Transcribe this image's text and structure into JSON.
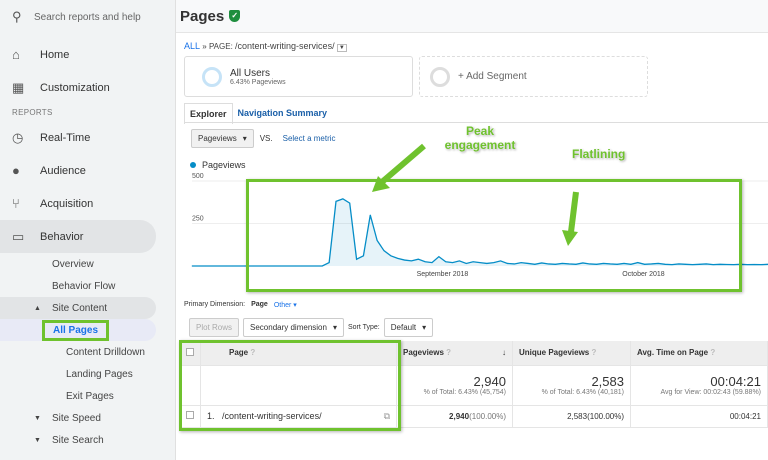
{
  "sidebar": {
    "search_placeholder": "Search reports and help",
    "home": "Home",
    "customization": "Customization",
    "reports_label": "REPORTS",
    "realtime": "Real-Time",
    "audience": "Audience",
    "acquisition": "Acquisition",
    "behavior": "Behavior",
    "overview": "Overview",
    "behavior_flow": "Behavior Flow",
    "site_content": "Site Content",
    "all_pages": "All Pages",
    "content_drilldown": "Content Drilldown",
    "landing_pages": "Landing Pages",
    "exit_pages": "Exit Pages",
    "site_speed": "Site Speed",
    "site_search": "Site Search"
  },
  "header": {
    "title": "Pages"
  },
  "breadcrumb": {
    "all": "ALL",
    "sep": "»",
    "page_label": "PAGE:",
    "page": "/content-writing-services/"
  },
  "segments": {
    "all_users": "All Users",
    "all_users_sub": "6.43% Pageviews",
    "add_segment": "+ Add Segment"
  },
  "tabs": [
    "Explorer",
    "Navigation Summary"
  ],
  "metric": {
    "selected": "Pageviews",
    "vs": "VS.",
    "select_metric": "Select a metric"
  },
  "annotations": {
    "peak": "Peak engagement",
    "flat": "Flatlining"
  },
  "colors": {
    "accent": "#6fc22e",
    "line": "#058dc7",
    "link": "#1a73e8"
  },
  "chart_data": {
    "type": "area",
    "legend": "Pageviews",
    "yticks": [
      500,
      250
    ],
    "ylim": [
      0,
      500
    ],
    "xticks": [
      "September 2018",
      "October 2018"
    ],
    "start_date": "2018-08-01",
    "values": [
      0,
      0,
      0,
      0,
      0,
      0,
      0,
      0,
      0,
      0,
      0,
      0,
      0,
      0,
      0,
      0,
      0,
      0,
      0,
      0,
      20,
      380,
      395,
      370,
      40,
      60,
      300,
      150,
      90,
      60,
      45,
      35,
      30,
      40,
      25,
      20,
      55,
      25,
      20,
      30,
      15,
      25,
      20,
      15,
      20,
      30,
      15,
      12,
      20,
      15,
      10,
      18,
      12,
      10,
      15,
      12,
      10,
      18,
      12,
      10,
      15,
      12,
      10,
      15,
      10,
      20,
      10,
      12,
      15,
      10,
      8,
      12,
      10,
      8,
      10,
      12,
      8,
      10,
      9,
      8,
      10,
      8,
      9,
      8,
      10
    ]
  },
  "dimension": {
    "label": "Primary Dimension:",
    "page": "Page",
    "other": "Other ▾"
  },
  "controls": {
    "plot_rows": "Plot Rows",
    "secondary": "Secondary dimension",
    "sort_type": "Sort Type:",
    "sort_value": "Default"
  },
  "table": {
    "headers": [
      "Page",
      "Pageviews",
      "Unique Pageviews",
      "Avg. Time on Page"
    ],
    "totals": {
      "pageviews": "2,940",
      "pageviews_sub": "% of Total: 6.43% (45,754)",
      "unique": "2,583",
      "unique_sub": "% of Total: 6.43% (40,181)",
      "time": "00:04:21",
      "time_sub": "Avg for View: 00:02:43 (59.88%)"
    },
    "rows": [
      {
        "index": "1.",
        "page": "/content-writing-services/",
        "pageviews": "2,940",
        "pageviews_pct": "(100.00%)",
        "unique": "2,583(100.00%)",
        "time": "00:04:21"
      }
    ]
  }
}
